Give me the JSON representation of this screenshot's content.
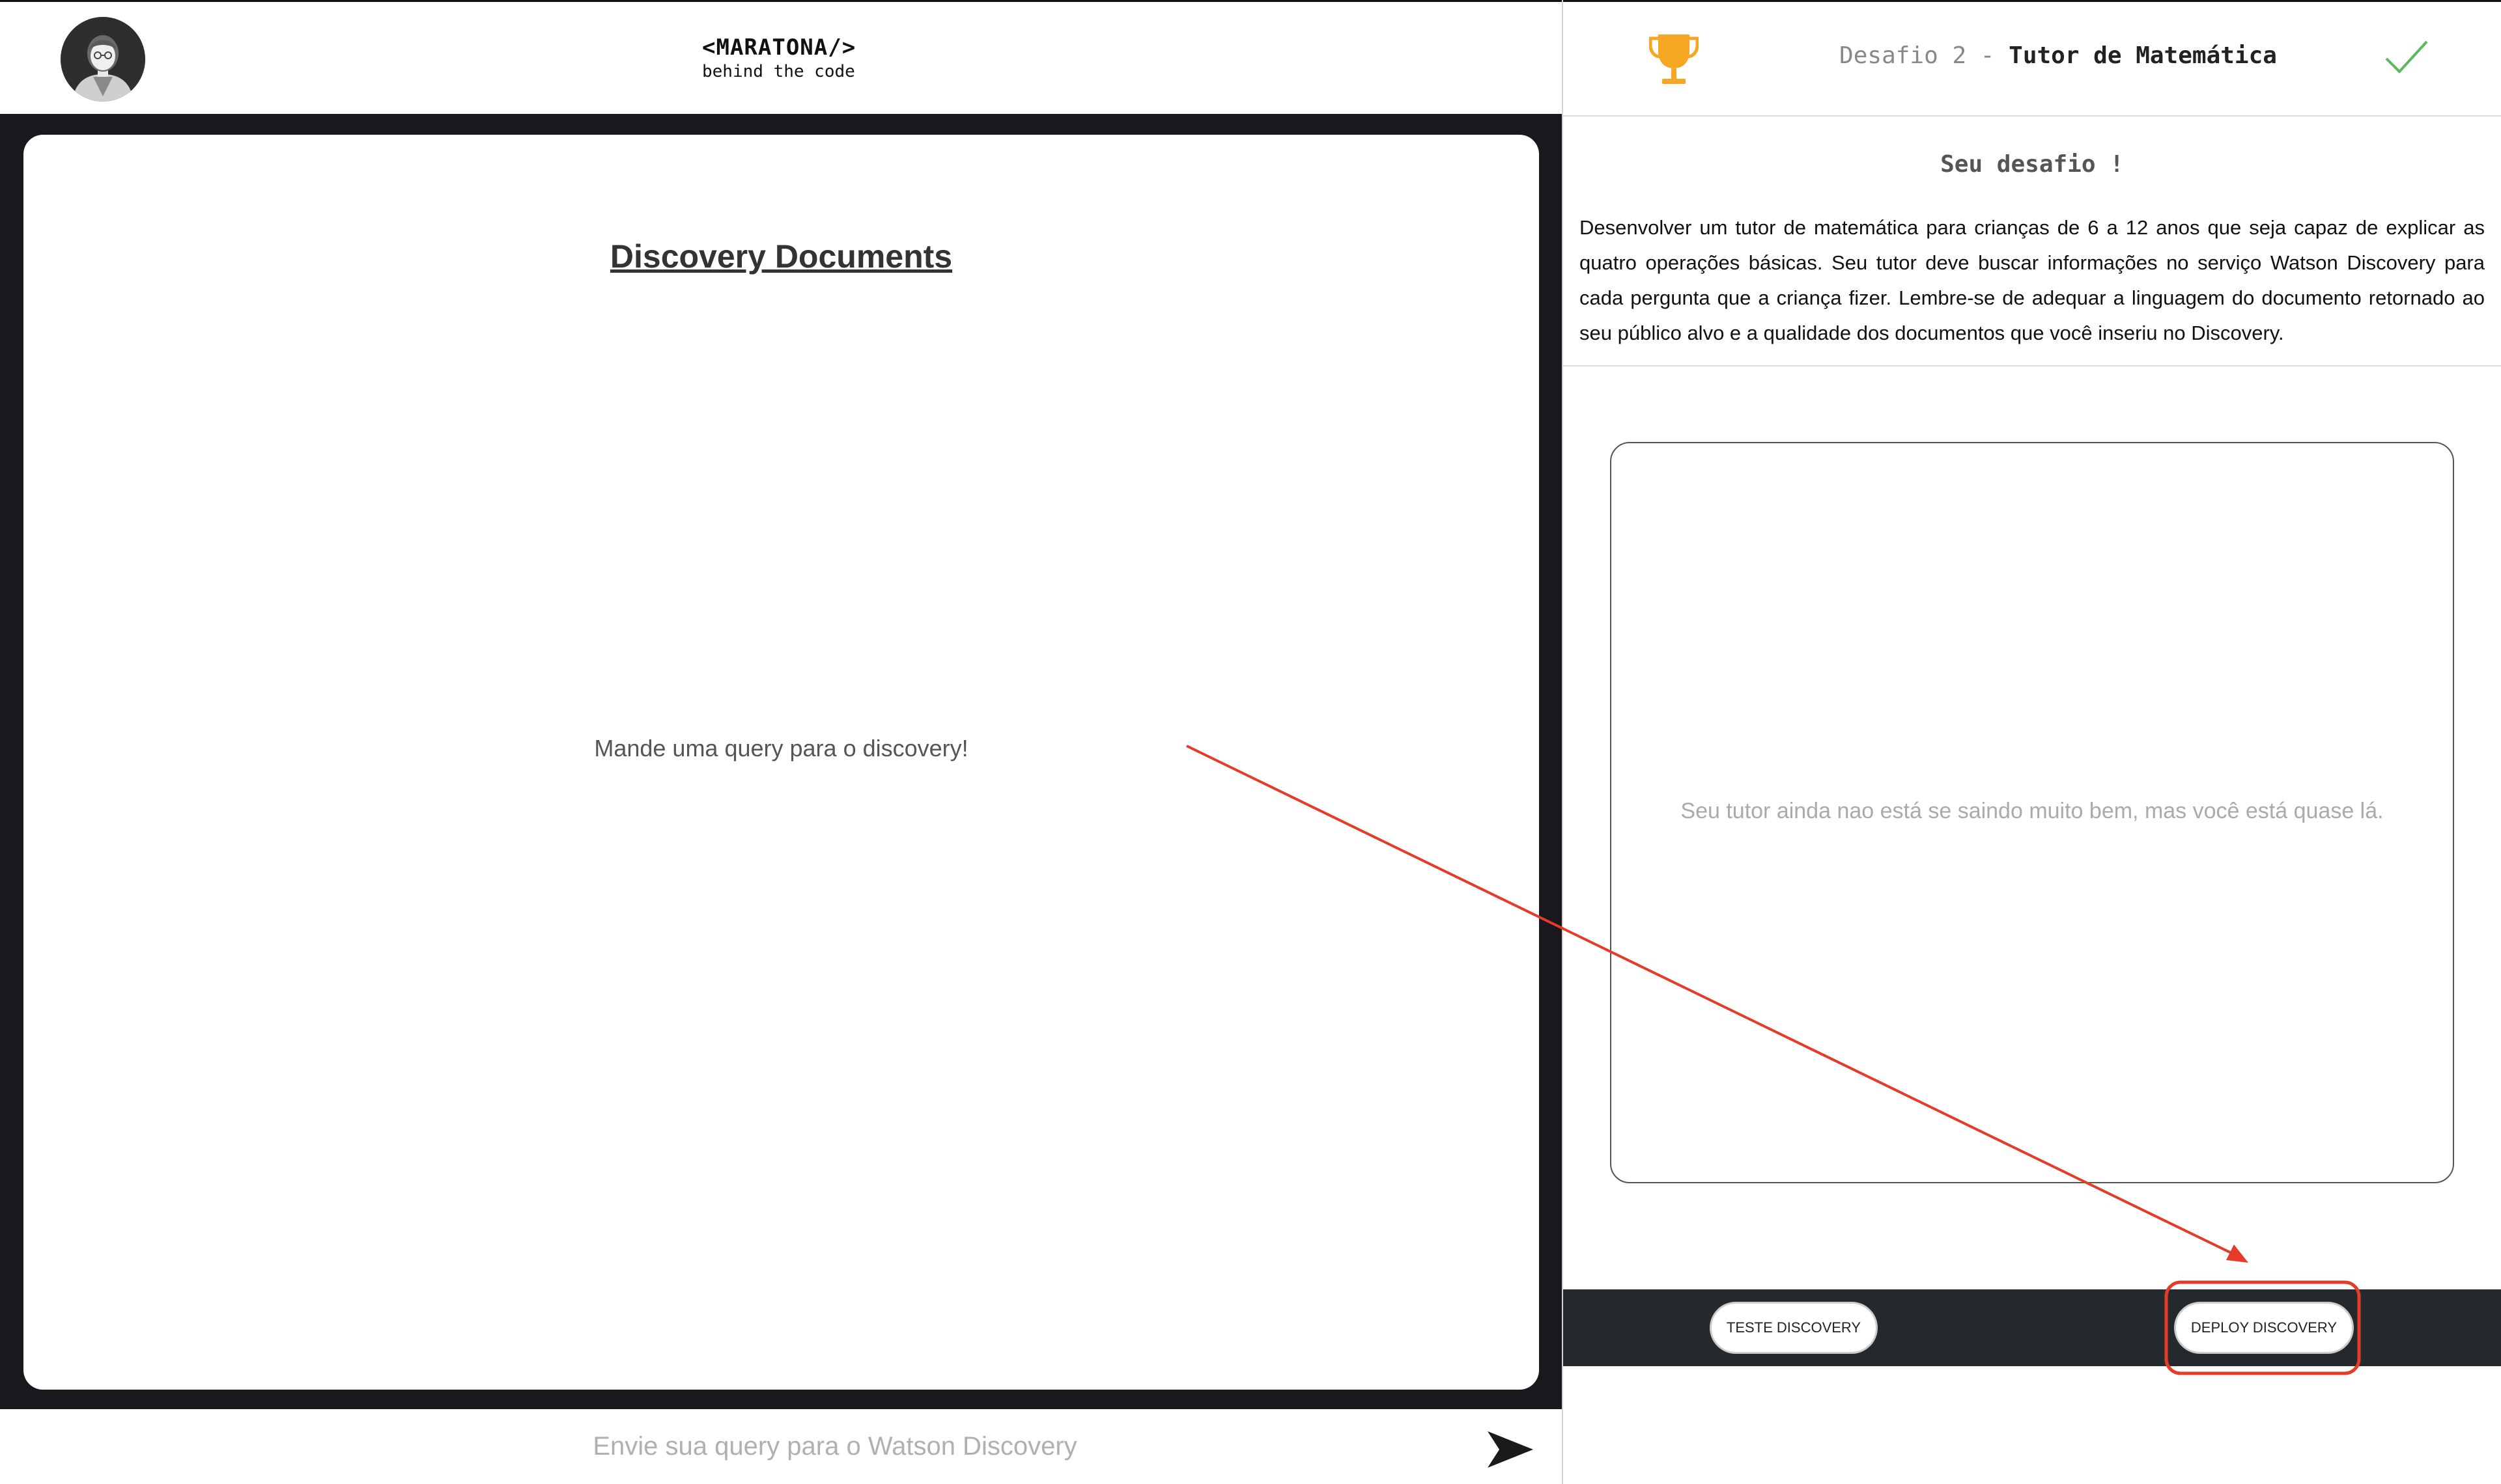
{
  "header": {
    "brand_title": "<MARATONA/>",
    "brand_subtitle": "behind the code",
    "avatar_icon": "user-avatar"
  },
  "documents": {
    "title": "Discovery Documents",
    "empty_message": "Mande uma query para o discovery!"
  },
  "query": {
    "placeholder": "Envie sua query para o Watson Discovery",
    "value": "",
    "send_icon": "send-arrow-icon"
  },
  "challenge": {
    "trophy_icon": "trophy-icon",
    "trophy_color": "#f5a623",
    "title_prefix": "Desafio 2 - ",
    "title_main": "Tutor de Matemática",
    "check_icon": "check-icon",
    "check_color": "#5cb85c",
    "heading": "Seu desafio !",
    "description": "Desenvolver um tutor de matemática para crianças de 6 a 12 anos que seja capaz de explicar as quatro operações básicas. Seu tutor deve buscar informações no serviço Watson Discovery para cada pergunta que a criança fizer. Lembre-se de adequar a linguagem do documento retornado ao seu público alvo e a qualidade dos documentos que você inseriu no Discovery."
  },
  "result": {
    "message": "Seu tutor ainda nao está se saindo muito bem, mas você está quase lá."
  },
  "actions": {
    "test_label": "TESTE DISCOVERY",
    "deploy_label": "DEPLOY DISCOVERY"
  },
  "annotation": {
    "color": "#e53c2a",
    "target": "deploy-button"
  }
}
